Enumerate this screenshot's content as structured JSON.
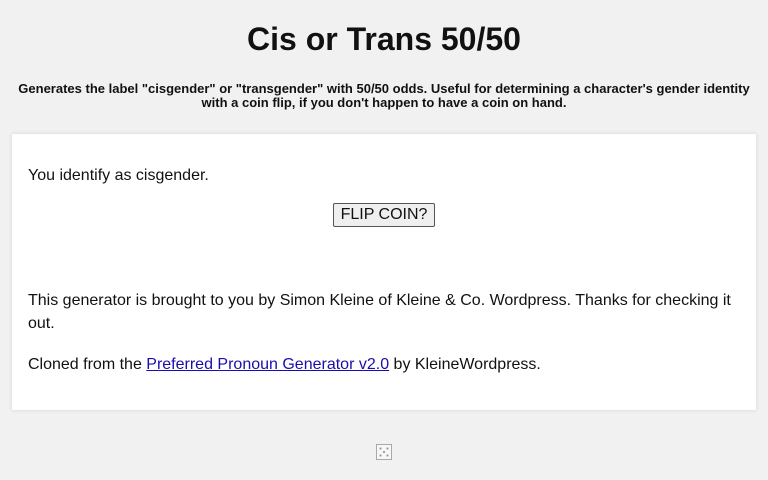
{
  "header": {
    "title": "Cis or Trans 50/50",
    "subtitle": "Generates the label \"cisgender\" or \"transgender\" with 50/50 odds. Useful for determining a character's gender identity with a coin flip, if you don't happen to have a coin on hand."
  },
  "card": {
    "result_text": "You identify as cisgender.",
    "flip_button_label": "FLIP COIN?",
    "credit_text": "This generator is brought to you by Simon Kleine of Kleine & Co. Wordpress. Thanks for checking it out.",
    "cloned_prefix": "Cloned from the ",
    "cloned_link_text": "Preferred Pronoun Generator v2.0",
    "cloned_suffix": " by KleineWordpress."
  },
  "footer": {
    "icon": "dice-icon"
  }
}
